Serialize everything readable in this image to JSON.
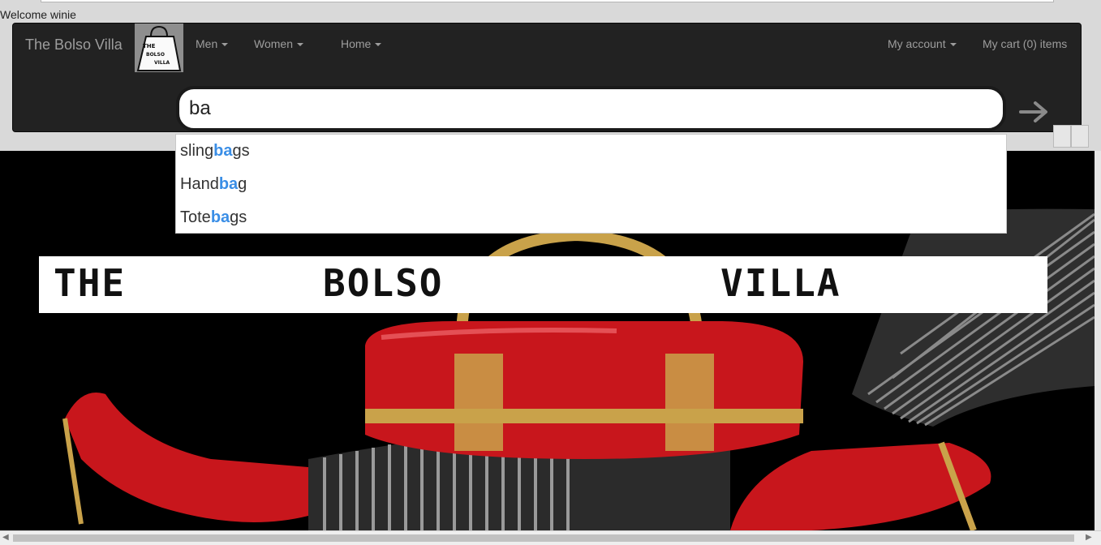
{
  "welcome_text": "Welcome winie",
  "navbar": {
    "brand": "The Bolso Villa",
    "logo_text": [
      "THE",
      "BOLSO",
      "VILLA"
    ],
    "menu": [
      {
        "label": "Men",
        "dropdown": true
      },
      {
        "label": "Women",
        "dropdown": true
      },
      {
        "label": "Home",
        "dropdown": true
      }
    ],
    "account": {
      "label": "My account",
      "dropdown": true
    },
    "cart": {
      "label": "My cart (0) items"
    }
  },
  "search": {
    "value": "ba",
    "submit_icon": "arrow-right-icon",
    "suggestions": [
      {
        "before": "sling",
        "match": "ba",
        "after": "gs"
      },
      {
        "before": "Hand",
        "match": "ba",
        "after": "g"
      },
      {
        "before": "Tote",
        "match": "ba",
        "after": "gs"
      }
    ]
  },
  "hero": {
    "banner_words": [
      "THE",
      "BOLSO",
      "VILLA"
    ],
    "image_description_icon": "red-handbag-heels-image"
  },
  "colors": {
    "navbar_bg": "#222222",
    "nav_text": "#9d9d9d",
    "highlight": "#3a8ee6",
    "hero_bg": "#000000",
    "bag_red": "#c8161c",
    "gold": "#c9a24a"
  }
}
